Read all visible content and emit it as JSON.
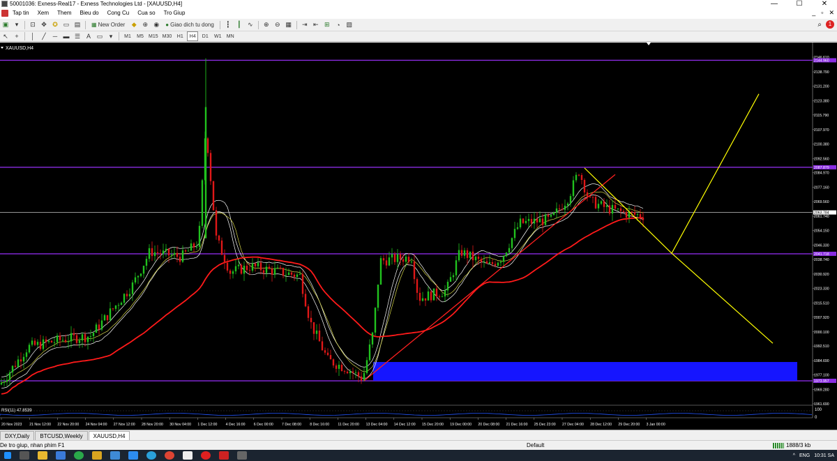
{
  "window": {
    "title": "50001036: Exness-Real17 - Exness Technologies Ltd - [XAUUSD,H4]",
    "controls": [
      "—",
      "☐",
      "✕"
    ]
  },
  "menu": {
    "items": [
      "Tap tin",
      "Xem",
      "Them",
      "Bieu do",
      "Cong Cu",
      "Cua so",
      "Tro Giup"
    ],
    "right_controls": [
      "_",
      "▫",
      "✕"
    ]
  },
  "toolbar": {
    "new_order": "New Order",
    "auto_trading": "Giao dich tu dong",
    "notification_count": "1"
  },
  "timeframes": [
    "M1",
    "M5",
    "M15",
    "M30",
    "H1",
    "H4",
    "D1",
    "W1",
    "MN"
  ],
  "active_timeframe": "H4",
  "chart": {
    "symbol_label": "XAUUSD,H4",
    "indicator_label": "RSI(11) 47.8539",
    "price_ticks": [
      "2146.610",
      "2138.790",
      "2131.200",
      "2123.380",
      "2115.790",
      "2107.970",
      "2100.380",
      "2092.560",
      "2084.970",
      "2077.160",
      "2069.560",
      "2061.740",
      "2054.150",
      "2046.330",
      "2038.740",
      "2030.920",
      "2023.330",
      "2015.510",
      "2007.920",
      "2000.100",
      "1992.510",
      "1984.690",
      "1977.100",
      "1969.280",
      "1961.690"
    ],
    "line_labels": {
      "resistance_top": "2144.960",
      "resistance_mid": "2087.879",
      "current_price": "2063.784",
      "support_mid": "2041.718",
      "support_bottom": "1973.957"
    },
    "rsi_ticks": [
      "100",
      "0"
    ],
    "time_ticks": [
      "20 Nov 2023",
      "21 Nov 12:00",
      "22 Nov 20:00",
      "24 Nov 04:00",
      "27 Nov 12:00",
      "28 Nov 20:00",
      "30 Nov 04:00",
      "1 Dec 12:00",
      "4 Dec 16:00",
      "6 Dec 00:00",
      "7 Dec 08:00",
      "8 Dec 16:00",
      "11 Dec 20:00",
      "13 Dec 04:00",
      "14 Dec 12:00",
      "15 Dec 20:00",
      "19 Dec 00:00",
      "20 Dec 08:00",
      "21 Dec 16:00",
      "25 Dec 23:00",
      "27 Dec 04:00",
      "28 Dec 12:00",
      "29 Dec 20:00",
      "3 Jan 00:00"
    ],
    "colors": {
      "background": "#000000",
      "bull": "#21c21e",
      "bear": "#e01818",
      "hline": "#8a2be2",
      "current_line": "#c8c8c8",
      "ma_slow": "#ff1a1a",
      "ma_fast": "#ffffff",
      "ma_mid": "#d8d84a",
      "trend_up": "#ff2020",
      "projection": "#ffff00",
      "zone": "#1515ff"
    }
  },
  "tabs": [
    "DXY,Daily",
    "BTCUSD,Weekly",
    "XAUUSD,H4"
  ],
  "active_tab": "XAUUSD,H4",
  "status": {
    "help": "De tro giup, nhan phim F1",
    "profile": "Default",
    "traffic": "1888/3 kb"
  },
  "taskbar": {
    "language": "ENG",
    "time": "10:31 SA"
  }
}
